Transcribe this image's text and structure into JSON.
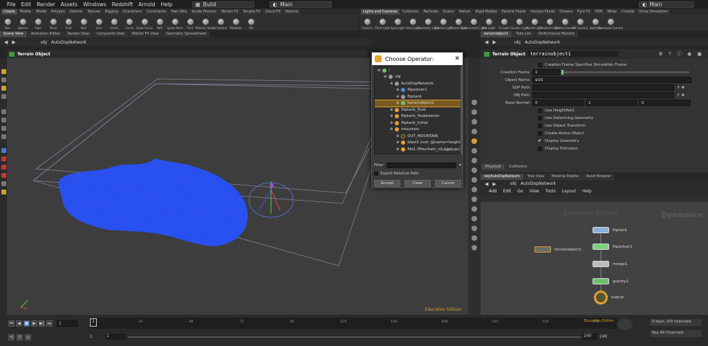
{
  "menubar": {
    "items": [
      "File",
      "Edit",
      "Render",
      "Assets",
      "Windows",
      "Redshift",
      "Arnold",
      "Help"
    ],
    "desktop": "Build",
    "scene": "Main",
    "right_desktop": "Main"
  },
  "shelf_tabs_left": [
    "Create",
    "Modify",
    "Model",
    "Polygon",
    "Deform",
    "Texture",
    "Rigging",
    "Characters",
    "Constraints",
    "Hair Utils",
    "Guide Process",
    "Terrain FX",
    "Simple FX",
    "Cloud FX",
    "Volume"
  ],
  "shelf_tabs_right": [
    "Lights and Cameras",
    "Collisions",
    "Particles",
    "Grains",
    "Vellum",
    "Rigid Bodies",
    "Particle Fluids",
    "Viscous Fluids",
    "Oceans",
    "Pyro FX",
    "FEM",
    "Wires",
    "Crowds",
    "Drive Simulation"
  ],
  "shelf_tools_left": [
    "Box",
    "Sphere",
    "Tube",
    "Torus",
    "Grid",
    "Null",
    "Line",
    "Circle",
    "Curve",
    "Draw Curve",
    "Path",
    "Spray Paint",
    "Font",
    "Platonic Solids",
    "L-System",
    "Metaball",
    "File"
  ],
  "shelf_tools_right": [
    "Camera",
    "Point Light",
    "Spot Light",
    "Area Light",
    "Geometry Light",
    "Volume Light",
    "Distant Light",
    "Environment Light",
    "Sky Light",
    "GI Light",
    "Caustic Light",
    "Portal Light",
    "Ambient Light",
    "Stereo Camera",
    "VR Camera",
    "Switcher",
    "Gamepad Camera"
  ],
  "viewport_tabs": [
    "Scene View",
    "Animation Editor",
    "Render View",
    "Composite View",
    "Motion FX View",
    "Geometry Spreadsheet"
  ],
  "viewport_path": [
    "obj",
    "AutoDopNetwork"
  ],
  "viewport_label": "Terrain Object",
  "viewport_watermark": "Education Edition",
  "right_tabs": [
    "terrainobject1",
    "Take List",
    "Performance Monitor"
  ],
  "right_path": [
    "obj",
    "AutoDopNetwork"
  ],
  "dialog": {
    "title": "Choose Operator:",
    "tree": [
      {
        "label": "/",
        "indent": 0,
        "kind": "green"
      },
      {
        "label": "obj",
        "indent": 1,
        "kind": "grey"
      },
      {
        "label": "AutoDopNetwork",
        "indent": 2,
        "kind": "grey"
      },
      {
        "label": "flipsolver1",
        "indent": 3,
        "kind": "blue"
      },
      {
        "label": "fliptank",
        "indent": 3,
        "kind": "grey"
      },
      {
        "label": "terrainobject1",
        "indent": 3,
        "kind": "green",
        "selected": true
      },
      {
        "label": "fliptank_fluid",
        "indent": 2,
        "kind": "orange"
      },
      {
        "label": "fliptank_fluidinterior",
        "indent": 2,
        "kind": "orange"
      },
      {
        "label": "fliptank_initial",
        "indent": 2,
        "kind": "orange"
      },
      {
        "label": "mountain",
        "indent": 2,
        "kind": "orange"
      },
      {
        "label": "OUT_MOUNTAIN",
        "indent": 3,
        "kind": "ring"
      },
      {
        "label": "blast1 (not: @name=height",
        "indent": 3,
        "kind": "orange"
      },
      {
        "label": "file1 (Mountain_v1.bgeo.sc)",
        "indent": 3,
        "kind": "orange"
      }
    ],
    "watermark": "Education",
    "filter_label": "Filter",
    "export_label": "Export Relative Path",
    "accept": "Accept",
    "clear": "Clear",
    "cancel": "Cancel"
  },
  "parm": {
    "type_label": "Terrain Object",
    "node_name": "terrainobject1",
    "creation_frame_check": "Creation Frame Specifies Simulation Frame",
    "creation_frame_label": "Creation Frame",
    "creation_frame_value": "1",
    "object_name_label": "Object Name",
    "object_name_value": "$OS",
    "sop_path_label": "SOP Path",
    "obj_path_label": "OBJ Path",
    "base_normal_label": "Base Normal",
    "base_normal": [
      "0",
      "1",
      "0"
    ],
    "toggles": [
      {
        "label": "Use Heightfield",
        "checked": false
      },
      {
        "label": "Use Deforming Geometry",
        "checked": false
      },
      {
        "label": "Use Object Transform",
        "checked": false
      },
      {
        "label": "Create Active Object",
        "checked": false
      },
      {
        "label": "Display Geometry",
        "checked": true
      },
      {
        "label": "Display Extrusion",
        "checked": false
      }
    ],
    "tabs": [
      "Physical",
      "Collisions"
    ]
  },
  "network": {
    "tabs": [
      "obj/AutoDopNetwork",
      "Tree View",
      "Material Palette",
      "Asset Browser"
    ],
    "path": [
      "obj",
      "AutoDopNetwork"
    ],
    "menu": [
      "Add",
      "Edit",
      "Go",
      "View",
      "Tools",
      "Layout",
      "Help"
    ],
    "watermark": "Education Edition",
    "context": "Dynamics",
    "nodes": [
      {
        "name": "fliptank",
        "color": "#8ab0d8"
      },
      {
        "name": "flipsolver1",
        "color": "#7ad07a"
      },
      {
        "name": "merge1",
        "color": "#bbbbbb"
      },
      {
        "name": "gravity1",
        "color": "#6cc06c"
      },
      {
        "name": "output",
        "color": "#e8a030"
      },
      {
        "name": "terrainobject1",
        "color": "#6c6c6c"
      }
    ]
  },
  "timeline": {
    "current_frame": "1",
    "ticks": [
      "24",
      "48",
      "72",
      "96",
      "120",
      "144",
      "168",
      "192",
      "216",
      "240"
    ],
    "start": "1",
    "start2": "1",
    "end": "240",
    "end2": "240",
    "keys_info": "0 keys, 0/0 channels",
    "key_all": "Key All Channels",
    "watermark": "Education Edition"
  }
}
